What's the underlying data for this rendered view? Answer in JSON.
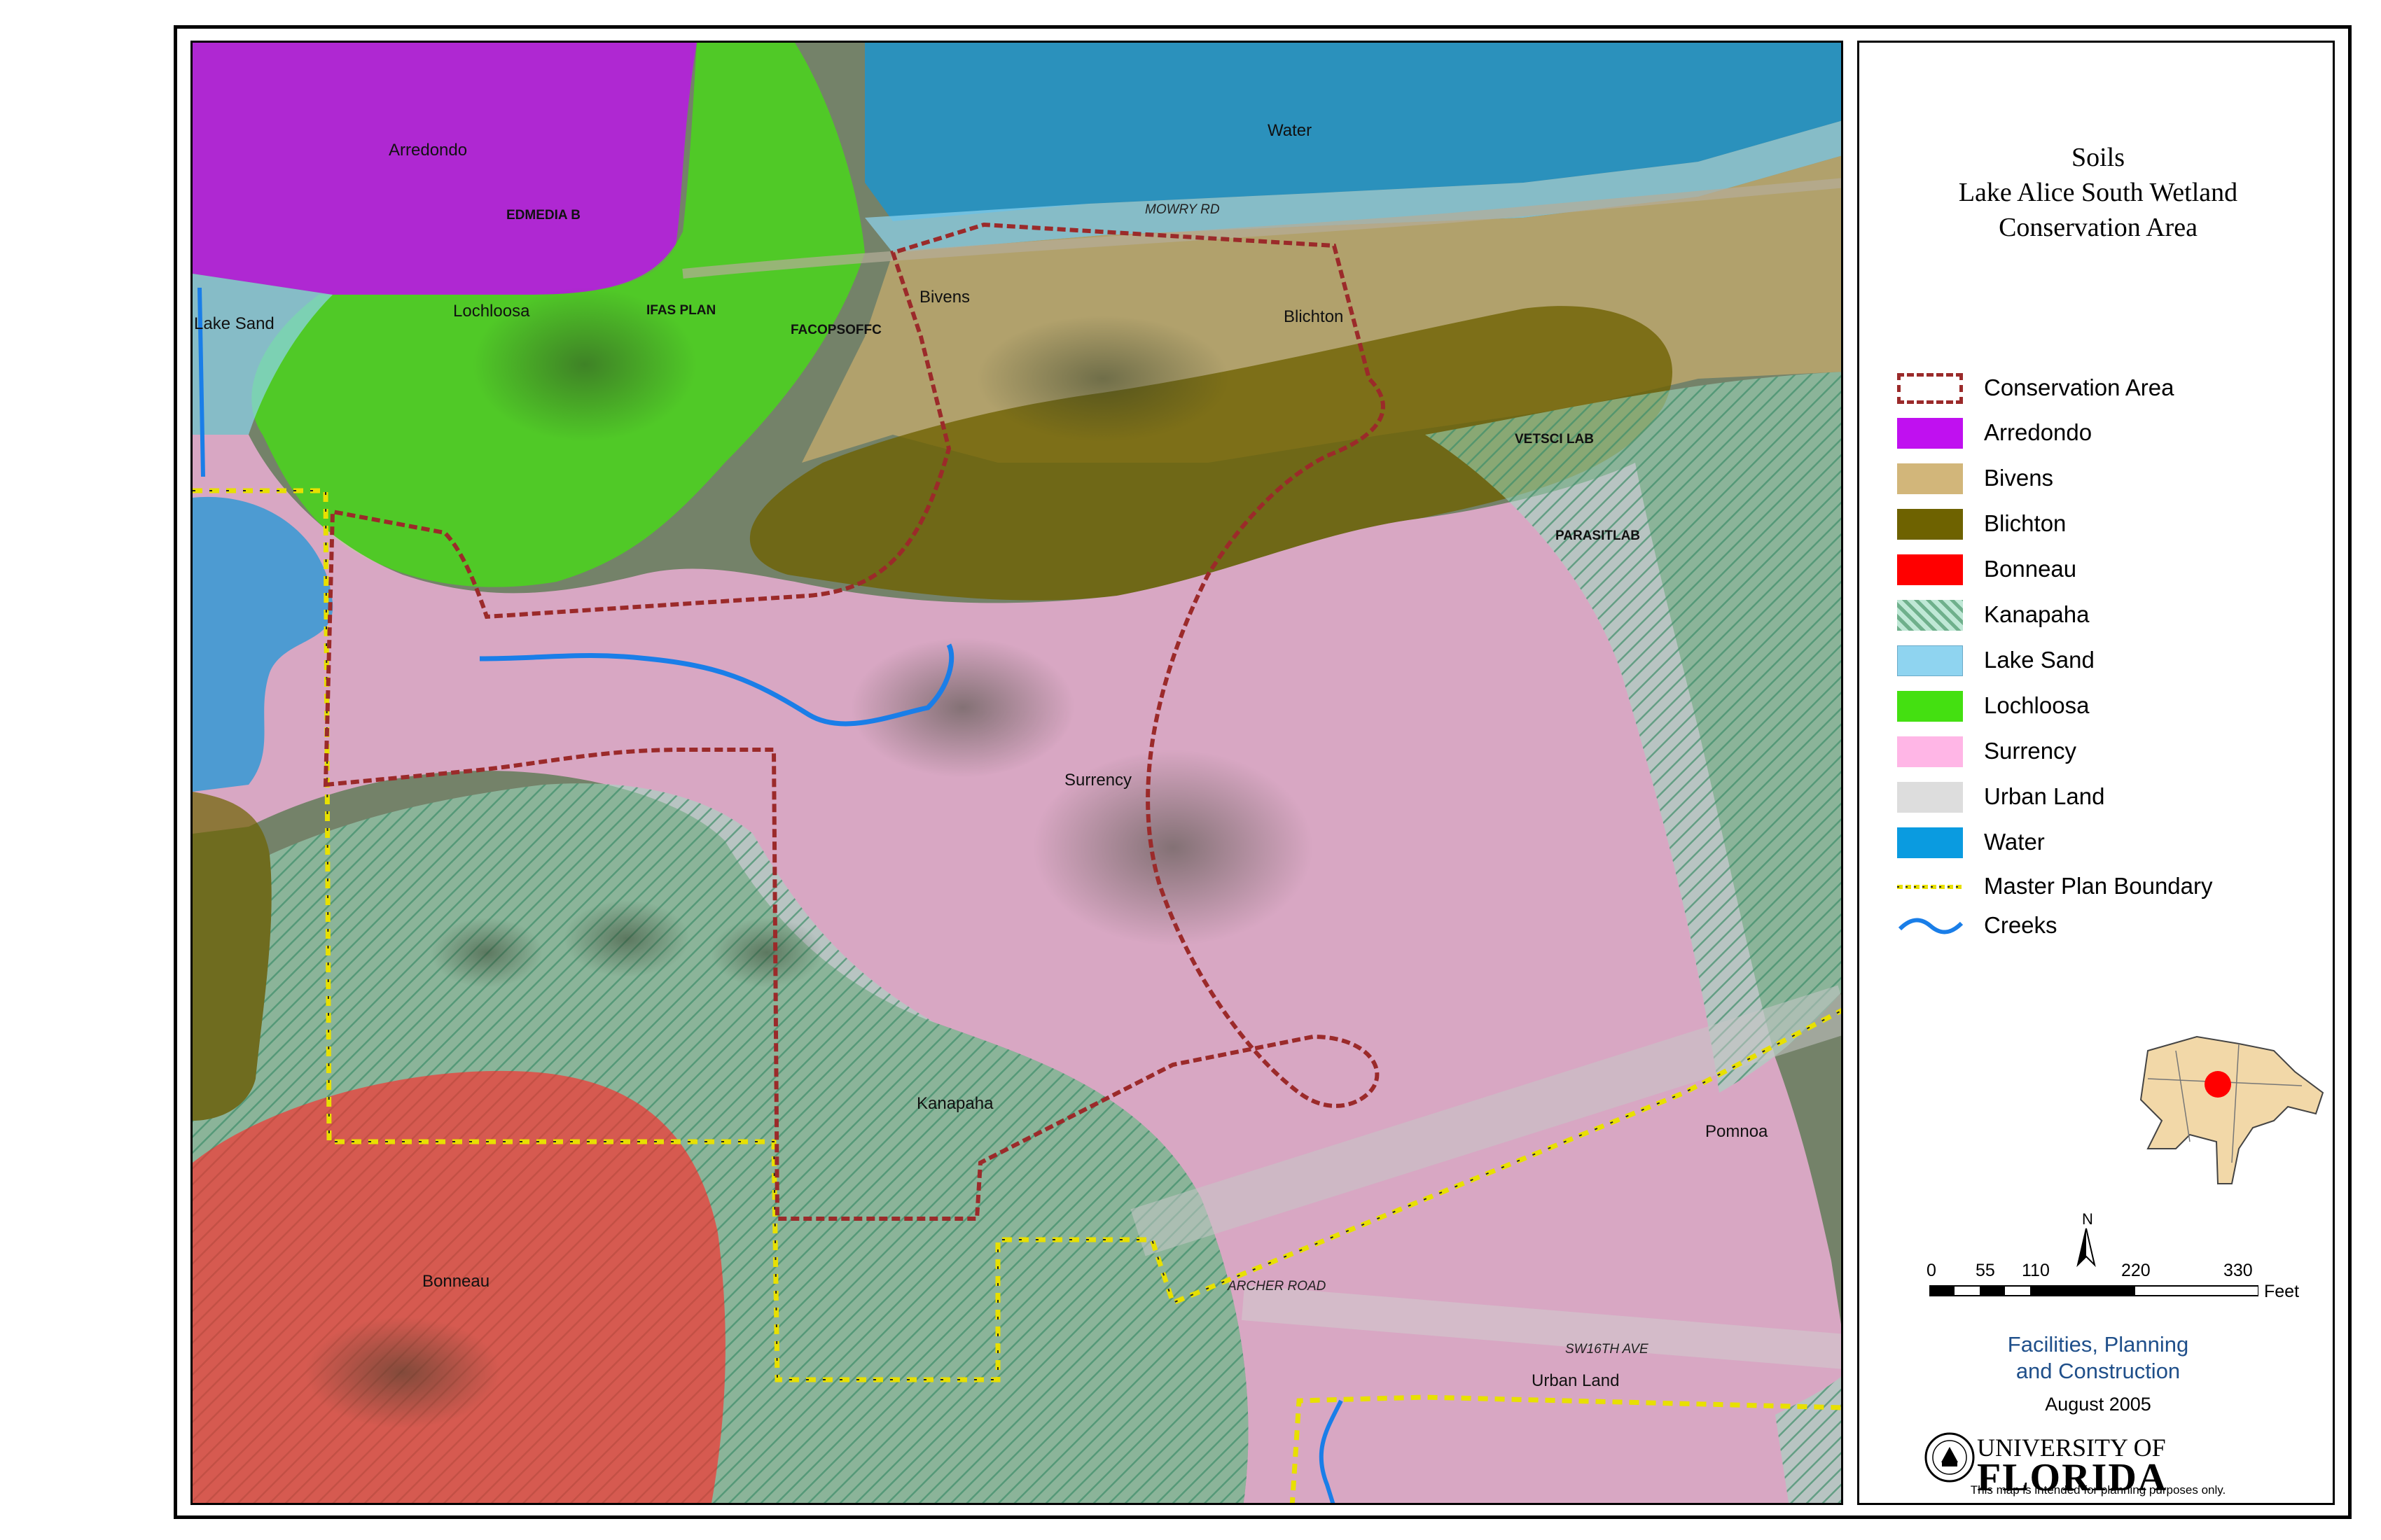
{
  "map": {
    "soil_labels": {
      "arredondo": "Arredondo",
      "lochloosa": "Lochloosa",
      "lake_sand": "Lake Sand",
      "bivens": "Bivens",
      "blichton": "Blichton",
      "water": "Water",
      "surrency": "Surrency",
      "kanapaha": "Kanapaha",
      "bonneau": "Bonneau",
      "pomona": "Pomnoa",
      "urban_land": "Urban Land"
    },
    "building_labels": {
      "edmedia": "EDMEDIA B",
      "ifas": "IFAS PLAN",
      "facops": "FACOPSOFFC",
      "vetsci": "VETSCI LAB",
      "parasit": "PARASITLAB"
    },
    "road_labels": {
      "mowry": "MOWRY RD",
      "archer": "ARCHER ROAD",
      "sw16": "SW16TH AVE"
    }
  },
  "title": {
    "line1": "Soils",
    "line2": "Lake Alice South Wetland",
    "line3": "Conservation Area"
  },
  "legend": {
    "conservation": "Conservation Area",
    "arredondo": "Arredondo",
    "bivens": "Bivens",
    "blichton": "Blichton",
    "bonneau": "Bonneau",
    "kanapaha": "Kanapaha",
    "lake_sand": "Lake Sand",
    "lochloosa": "Lochloosa",
    "surrency": "Surrency",
    "urban_land": "Urban Land",
    "water": "Water",
    "master_plan": "Master Plan Boundary",
    "creeks": "Creeks"
  },
  "colors": {
    "arredondo": "#c010f0",
    "bivens": "#d2b67a",
    "blichton": "#6e6200",
    "bonneau": "#ff0000",
    "kanapaha_hatch": "#7fbf9a",
    "lake_sand": "#8fd4f0",
    "lochloosa": "#44e011",
    "surrency": "#ffb6e6",
    "urban_land": "#dddddd",
    "water": "#0a9be0",
    "conservation_line": "#9b2a2a",
    "master_plan_line": "#e8e000",
    "creek": "#1a7ee8"
  },
  "scale": {
    "ticks": [
      "0",
      "55",
      "110",
      "220",
      "330"
    ],
    "unit": "Feet",
    "north": "N"
  },
  "credits": {
    "line1": "Facilities, Planning",
    "line2": "and Construction",
    "date": "August 2005"
  },
  "university": {
    "line1": "UNIVERSITY OF",
    "line2": "FLORIDA"
  },
  "disclaimer": "This map is intended for planning purposes only."
}
